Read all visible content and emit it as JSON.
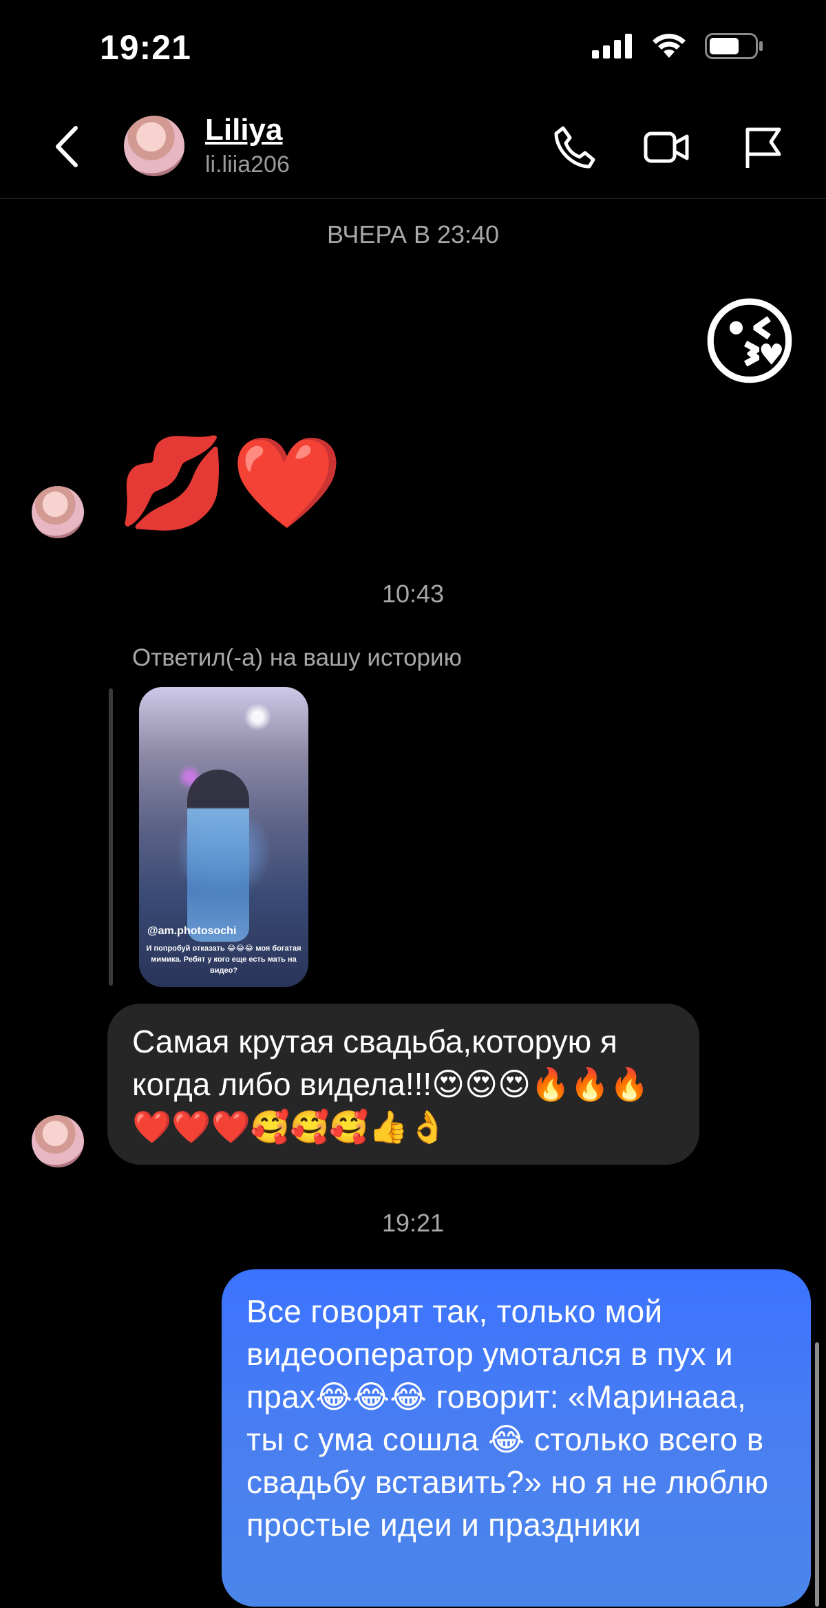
{
  "status_bar": {
    "time": "19:21"
  },
  "header": {
    "contact_name": "Liliya",
    "contact_username": "li.liia206"
  },
  "messages": {
    "date_sep_1": "ВЧЕРА В 23:40",
    "sent_emoji": "😘",
    "received_emojis": "💋❤️",
    "time_sep_2": "10:43",
    "story_reply_label": "Ответил(-а) на вашу историю",
    "story": {
      "mention": "@am.photosochi",
      "caption": "И попробуй отказать 😂😂😂 моя богатая мимика. Ребят у кого еще есть мать на видео?"
    },
    "received_text": "Самая крутая свадьба,которую я когда либо видела!!!😍😍😍🔥🔥🔥❤️❤️❤️🥰🥰🥰👍👌",
    "time_sep_3": "19:21",
    "sent_text": "Все говорят так, только мой видеооператор умотался в пух и прах😂😂😂 говорит: «Маринааа, ты с ума сошла 😂 столько всего в свадьбу вставить?» но я не люблю простые идеи и праздники"
  },
  "icons": [
    "signal-icon",
    "wifi-icon",
    "battery-icon",
    "back-arrow-icon",
    "phone-icon",
    "video-camera-icon",
    "flag-icon"
  ],
  "colors": {
    "background": "#000000",
    "sent_bubble": "#3b73ff",
    "received_bubble": "#262626",
    "secondary_text": "#a8a8a8"
  }
}
